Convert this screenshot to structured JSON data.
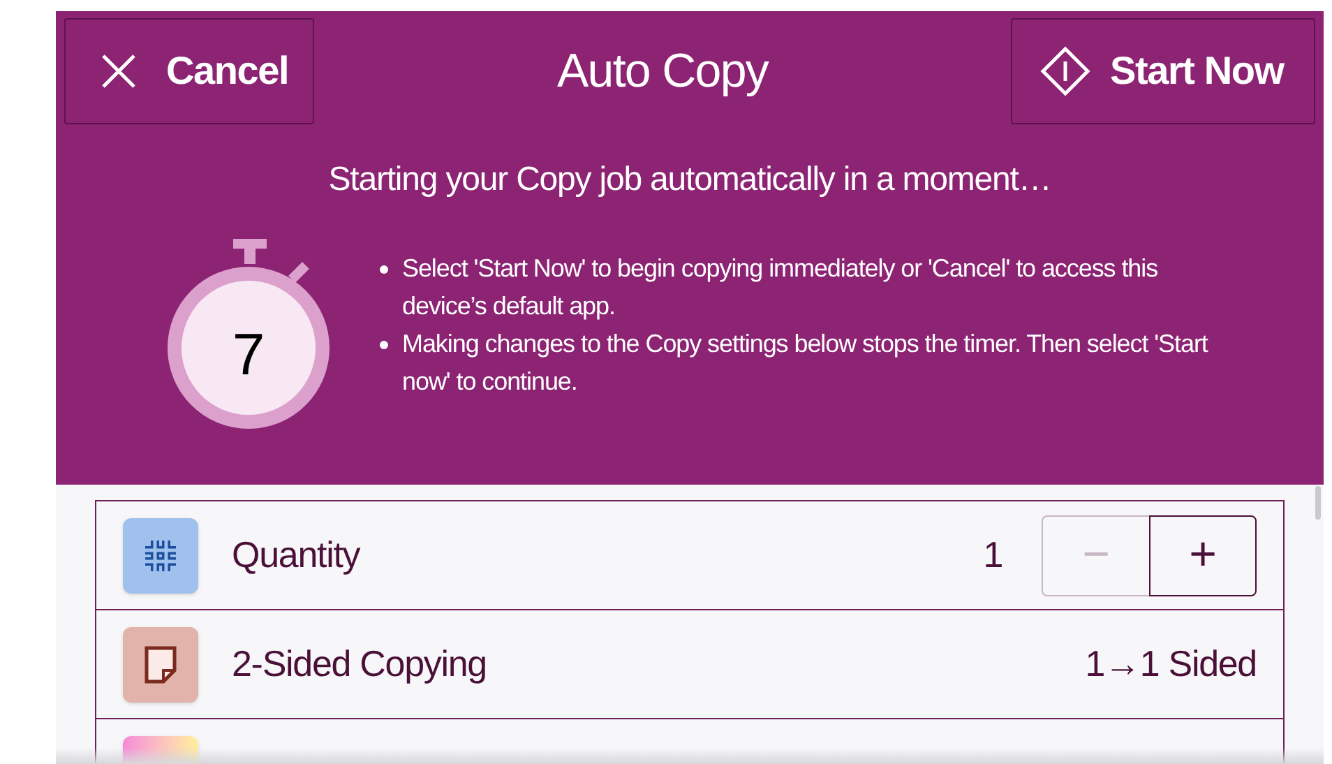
{
  "header": {
    "cancel": "Cancel",
    "title": "Auto Copy",
    "start": "Start Now"
  },
  "banner": {
    "heading": "Starting your Copy job automatically in a moment…",
    "countdown": "7",
    "bullets": [
      "Select 'Start Now' to begin copying immediately or 'Cancel' to access this device’s default app.",
      "Making changes to the Copy settings below stops the timer. Then select 'Start now' to continue."
    ]
  },
  "settings": [
    {
      "kind": "stepper",
      "label": "Quantity",
      "value": "1",
      "decrement": {
        "symbol": "−",
        "disabled": true
      },
      "increment": {
        "symbol": "+",
        "disabled": false
      }
    },
    {
      "kind": "value",
      "label": "2-Sided Copying",
      "value": "1→1 Sided"
    },
    {
      "kind": "value"
    }
  ]
}
